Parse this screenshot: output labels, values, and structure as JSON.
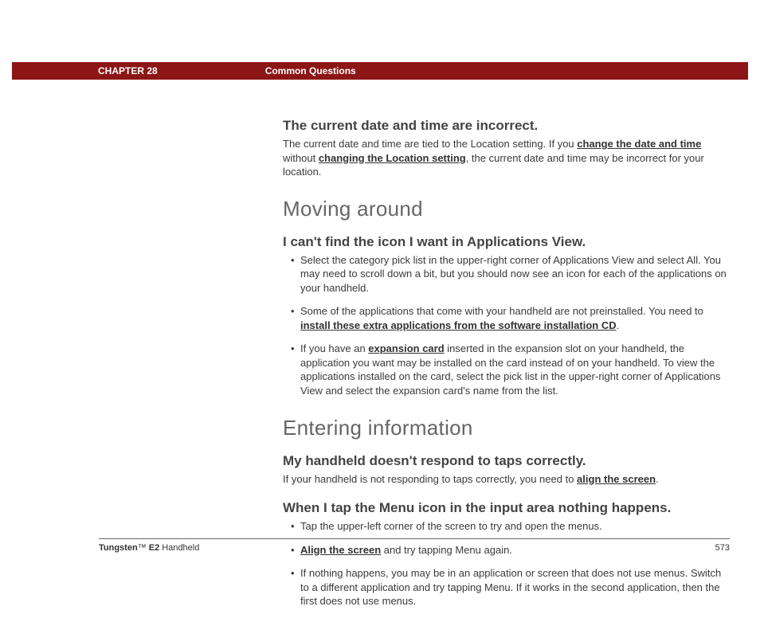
{
  "header": {
    "chapter": "CHAPTER 28",
    "section": "Common Questions"
  },
  "q1": {
    "title": "The current date and time are incorrect.",
    "p1_a": "The current date and time are tied to the Location setting. If you ",
    "link1": "change the date and time",
    "p1_b": " without ",
    "link2": "changing the Location setting",
    "p1_c": ", the current date and time may be incorrect for your location."
  },
  "sec1": {
    "title": "Moving around"
  },
  "q2": {
    "title": "I can't find the icon I want in Applications View.",
    "li1": "Select the category pick list in the upper-right corner of Applications View and select All. You may need to scroll down a bit, but you should now see an icon for each of the applications on your handheld.",
    "li2_a": "Some of the applications that come with your handheld are not preinstalled. You need to ",
    "li2_link": "install these extra applications from the software installation CD",
    "li2_b": ".",
    "li3_a": "If you have an ",
    "li3_link": "expansion card",
    "li3_b": " inserted in the expansion slot on your handheld, the application you want may be installed on the card instead of on your handheld. To view the applications installed on the card, select the pick list in the upper-right corner of Applications View and select the expansion card's name from the list."
  },
  "sec2": {
    "title": "Entering information"
  },
  "q3": {
    "title": "My handheld doesn't respond to taps correctly.",
    "p_a": "If your handheld is not responding to taps correctly, you need to ",
    "link": "align the screen",
    "p_b": "."
  },
  "q4": {
    "title": "When I tap the Menu icon in the input area nothing happens.",
    "li1": "Tap the upper-left corner of the screen to try and open the menus.",
    "li2_link": "Align the screen",
    "li2_b": " and try tapping Menu again.",
    "li3": "If nothing happens, you may be in an application or screen that does not use menus. Switch to a different application and try tapping Menu. If it works in the second application, then the first does not use menus."
  },
  "footer": {
    "brand": "Tungsten",
    "tm": "™",
    "model": " E2",
    "kind": " Handheld",
    "page": "573"
  }
}
